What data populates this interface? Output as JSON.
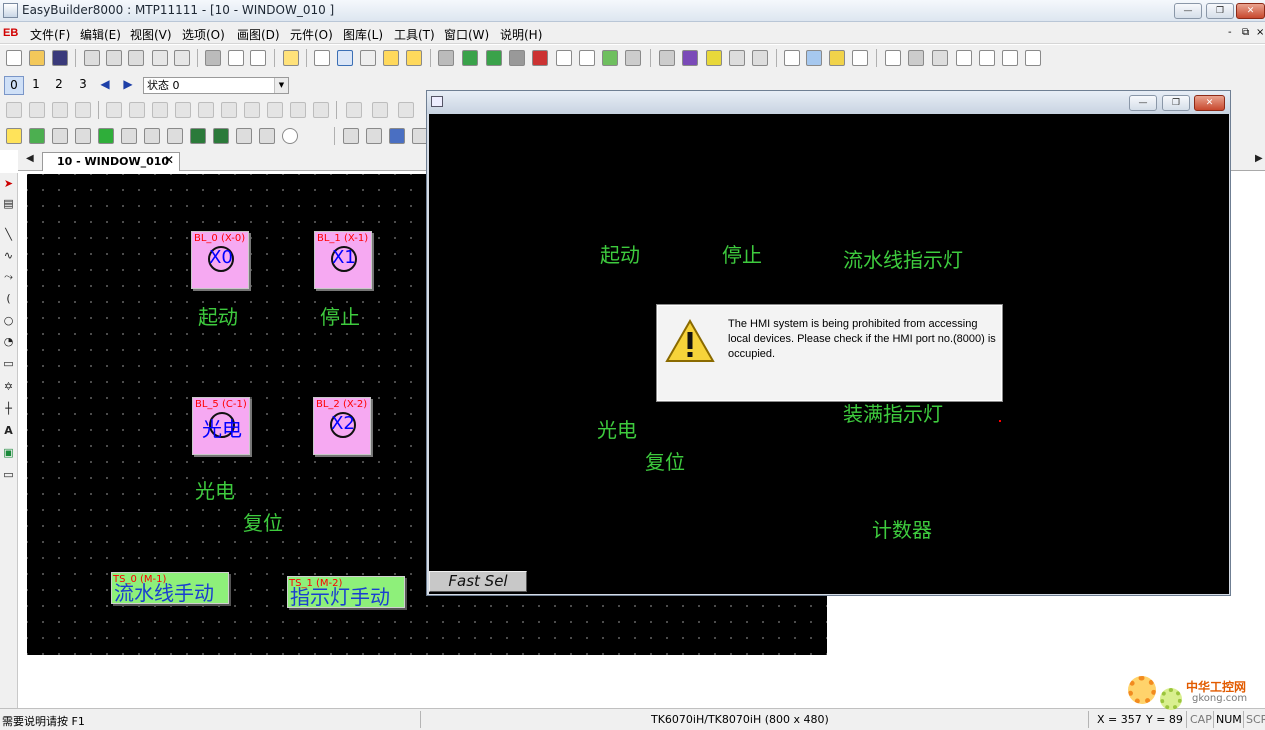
{
  "titlebar": {
    "title": "EasyBuilder8000 : MTP11111 - [10 - WINDOW_010 ]",
    "minimize": "—",
    "maximize": "❐",
    "close": "✕"
  },
  "menubar": {
    "logo": "EB",
    "items": [
      "文件(F)",
      "编辑(E)",
      "视图(V)",
      "选项(O)",
      "画图(D)",
      "元件(O)",
      "图库(L)",
      "工具(T)",
      "窗口(W)",
      "说明(H)"
    ],
    "mdi_controls": [
      "-",
      "⧉",
      "×"
    ]
  },
  "state_toolbar": {
    "buttons": [
      "0",
      "1",
      "2",
      "3"
    ],
    "prev": "◀",
    "next": "▶",
    "selected_state": "状态 0"
  },
  "tab": {
    "label": "10 - WINDOW_010",
    "close": "✕"
  },
  "canvas": {
    "lamps": [
      {
        "label": "BL_0 (X-0)",
        "text": "X0"
      },
      {
        "label": "BL_1 (X-1)",
        "text": "X1"
      },
      {
        "label": "BL_5 (C-1)",
        "text": "光电"
      },
      {
        "label": "BL_2 (X-2)",
        "text": "X2"
      }
    ],
    "texts": [
      "起动",
      "停止",
      "光电",
      "复位"
    ],
    "toggles": [
      {
        "label": "TS_0 (M-1)",
        "text": "流水线手动"
      },
      {
        "label": "TS_1 (M-2)",
        "text": "指示灯手动"
      }
    ]
  },
  "simulator": {
    "texts": [
      "起动",
      "停止",
      "流水线指示灯",
      "装满指示灯",
      "光电",
      "复位",
      "计数器"
    ],
    "fast_sel": "Fast Sel",
    "message": "The HMI system is being prohibited from accessing local devices. Please check if the HMI port no.(8000) is occupied."
  },
  "statusbar": {
    "help": "需要说明请按 F1",
    "model": "TK6070iH/TK8070iH (800 x 480)",
    "x": "X = 357",
    "y": "Y = 89",
    "cap": "CAP",
    "num": "NUM",
    "scrl": "SCR"
  },
  "watermark": {
    "cn": "中华工控网",
    "url": "gkong.com"
  },
  "colors": {
    "canvas_bg": "#000000",
    "lamp_fill": "#f6a9f2",
    "green_text": "#3ecb3e",
    "toggle_fill": "#8ef07a",
    "label_red": "#ff0000"
  }
}
